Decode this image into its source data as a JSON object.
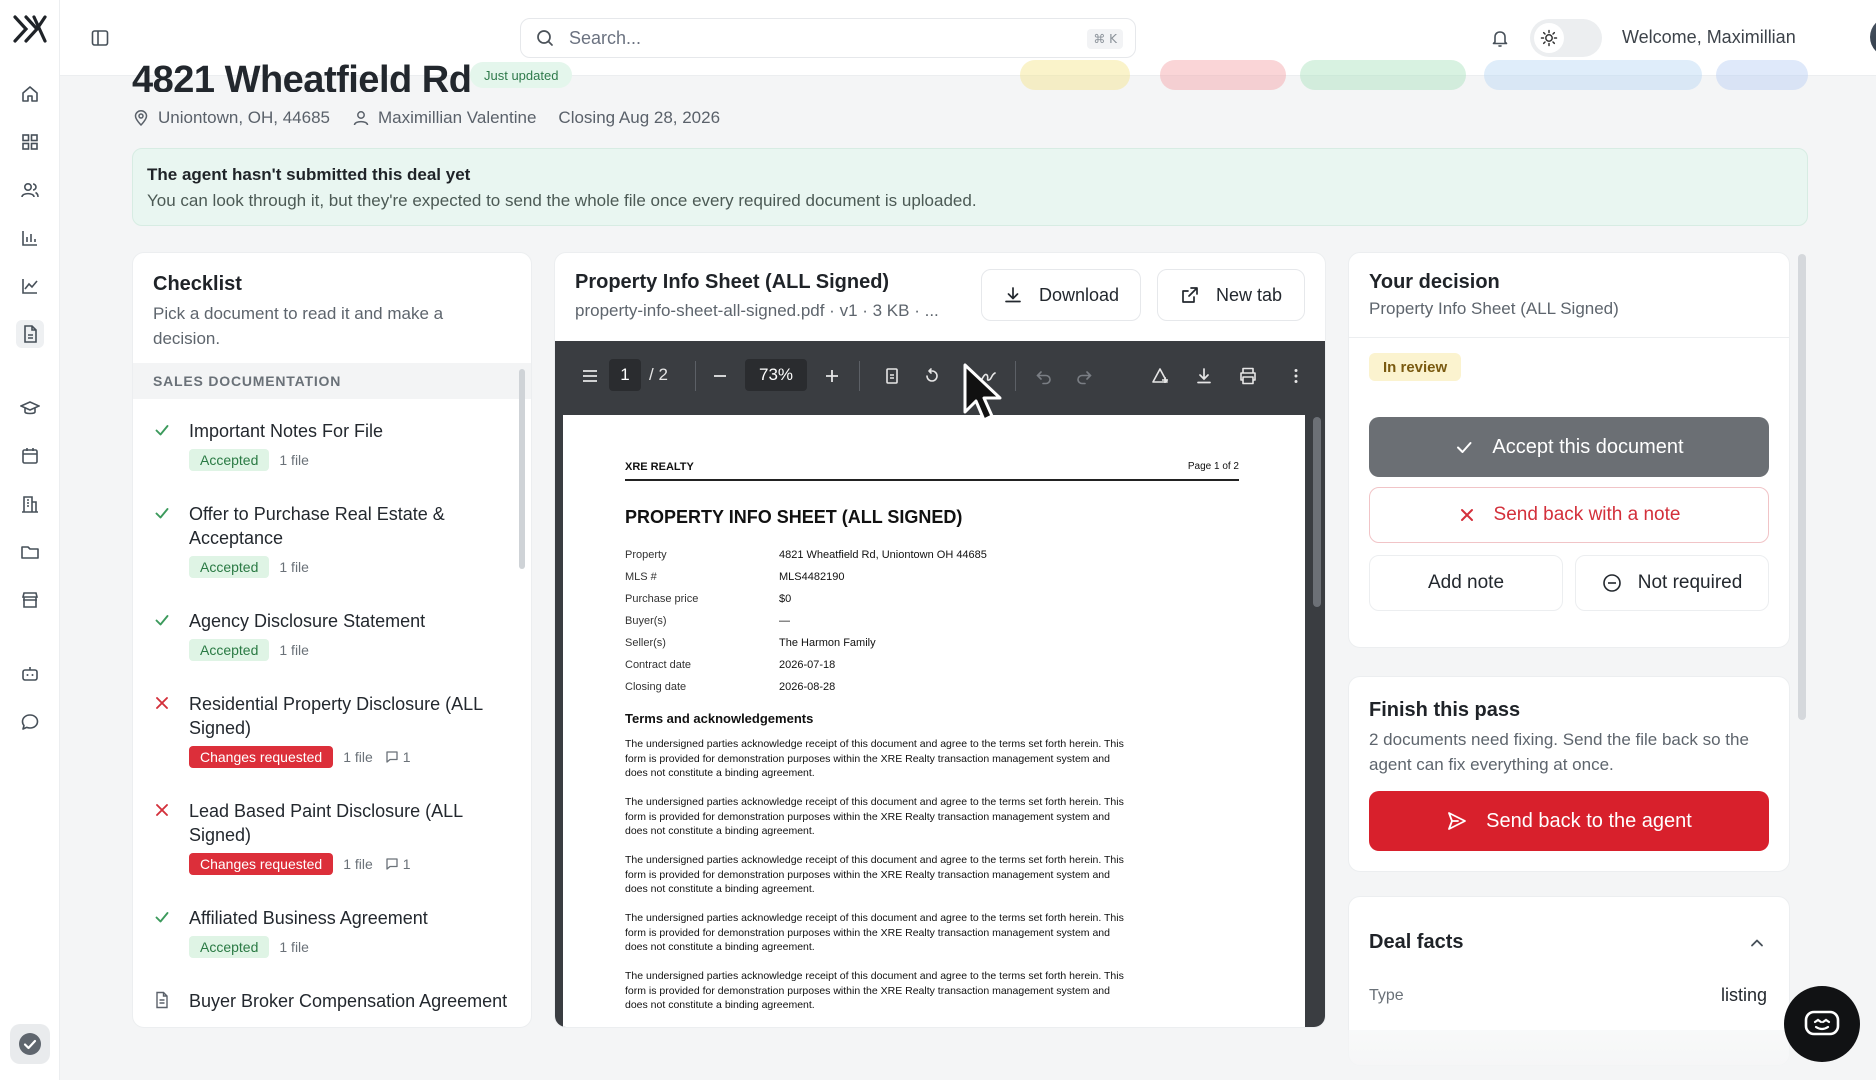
{
  "sidebar": {
    "items": [
      "home-icon",
      "grid-icon",
      "users-icon",
      "bar-chart-icon",
      "line-chart-icon",
      "document-icon",
      "graduation-icon",
      "calendar-icon",
      "building-icon",
      "folder-icon",
      "store-icon",
      "bot-icon",
      "chat-icon"
    ]
  },
  "topbar": {
    "search_placeholder": "Search...",
    "search_shortcut": "⌘ K",
    "welcome": "Welcome, Maximillian"
  },
  "header": {
    "title": "4821 Wheatfield Rd",
    "updated_badge": "Just updated",
    "location": "Uniontown, OH, 44685",
    "agent": "Maximillian Valentine",
    "closing": "Closing Aug 28, 2026"
  },
  "notice": {
    "title": "The agent hasn't submitted this deal yet",
    "text": "You can look through it, but they're expected to send the whole file once every required document is uploaded."
  },
  "checklist": {
    "title": "Checklist",
    "subtitle": "Pick a document to read it and make a decision.",
    "section": "SALES DOCUMENTATION",
    "items": [
      {
        "name": "Important Notes For File",
        "status": "Accepted",
        "files": "1 file",
        "state": "accepted"
      },
      {
        "name": "Offer to Purchase Real Estate & Acceptance",
        "status": "Accepted",
        "files": "1 file",
        "state": "accepted"
      },
      {
        "name": "Agency Disclosure Statement",
        "status": "Accepted",
        "files": "1 file",
        "state": "accepted"
      },
      {
        "name": "Residential Property Disclosure (ALL Signed)",
        "status": "Changes requested",
        "files": "1 file",
        "comments": "1",
        "state": "changes"
      },
      {
        "name": "Lead Based Paint Disclosure (ALL Signed)",
        "status": "Changes requested",
        "files": "1 file",
        "comments": "1",
        "state": "changes"
      },
      {
        "name": "Affiliated Business Agreement",
        "status": "Accepted",
        "files": "1 file",
        "state": "accepted"
      },
      {
        "name": "Buyer Broker Compensation Agreement",
        "state": "pending"
      }
    ]
  },
  "viewer": {
    "title": "Property Info Sheet (ALL Signed)",
    "file": "property-info-sheet-all-signed.pdf · v1 · 3 KB · ...",
    "download": "Download",
    "new_tab": "New tab",
    "toolbar": {
      "page": "1",
      "total": "/ 2",
      "zoom": "73%"
    },
    "pdf": {
      "brand": "XRE REALTY",
      "page_label": "Page 1 of 2",
      "heading": "PROPERTY INFO SHEET (ALL SIGNED)",
      "fields": [
        {
          "k": "Property",
          "v": "4821 Wheatfield Rd, Uniontown OH 44685"
        },
        {
          "k": "MLS #",
          "v": "MLS4482190"
        },
        {
          "k": "Purchase price",
          "v": "$0"
        },
        {
          "k": "Buyer(s)",
          "v": "—"
        },
        {
          "k": "Seller(s)",
          "v": "The Harmon Family"
        },
        {
          "k": "Contract date",
          "v": "2026-07-18"
        },
        {
          "k": "Closing date",
          "v": "2026-08-28"
        }
      ],
      "section": "Terms and acknowledgements",
      "paragraph": "The undersigned parties acknowledge receipt of this document and agree to the terms set forth herein. This form is provided for demonstration purposes within the XRE Realty transaction management system and does not constitute a binding agreement."
    }
  },
  "decision": {
    "title": "Your decision",
    "subtitle": "Property Info Sheet (ALL Signed)",
    "status": "In review",
    "accept": "Accept this document",
    "send_note": "Send back with a note",
    "add_note": "Add note",
    "not_required": "Not required"
  },
  "finish": {
    "title": "Finish this pass",
    "text": "2 documents need fixing. Send the file back so the agent can fix everything at once.",
    "button": "Send back to the agent"
  },
  "facts": {
    "title": "Deal facts",
    "type_key": "Type",
    "type_val": "listing"
  },
  "colors": {
    "accent_red": "#d8202c",
    "accepted_bg": "#dff4e5",
    "notice_bg": "#e9f6f1",
    "review_bg": "#fbf3cf"
  }
}
